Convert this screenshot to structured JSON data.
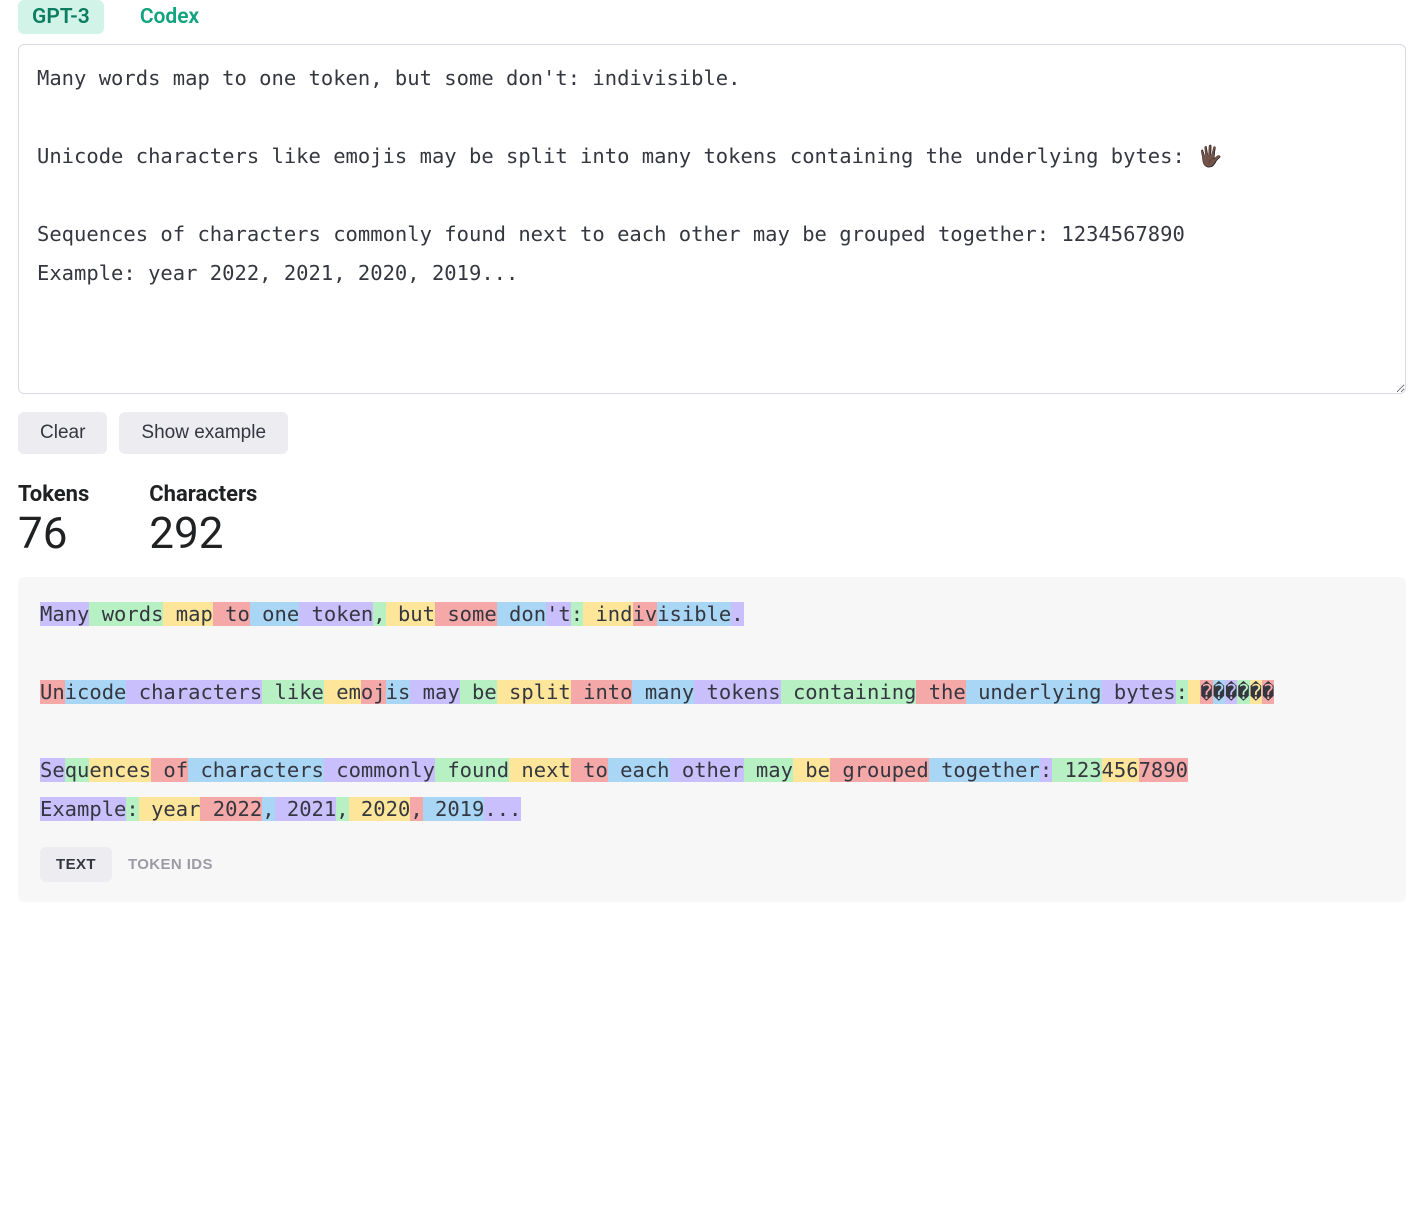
{
  "tabs": {
    "items": [
      {
        "label": "GPT-3",
        "active": true
      },
      {
        "label": "Codex",
        "active": false
      }
    ]
  },
  "input": {
    "text": "Many words map to one token, but some don't: indivisible.\n\nUnicode characters like emojis may be split into many tokens containing the underlying bytes: 🖐🏿\n\nSequences of characters commonly found next to each other may be grouped together: 1234567890\nExample: year 2022, 2021, 2020, 2019..."
  },
  "buttons": {
    "clear": "Clear",
    "show_example": "Show example"
  },
  "stats": {
    "tokens_label": "Tokens",
    "tokens_value": "76",
    "characters_label": "Characters",
    "characters_value": "292"
  },
  "tokenized": {
    "tokens": [
      {
        "t": "Many",
        "c": 0
      },
      {
        "t": " words",
        "c": 1
      },
      {
        "t": " map",
        "c": 2
      },
      {
        "t": " to",
        "c": 3
      },
      {
        "t": " one",
        "c": 4
      },
      {
        "t": " token",
        "c": 0
      },
      {
        "t": ",",
        "c": 1
      },
      {
        "t": " but",
        "c": 2
      },
      {
        "t": " some",
        "c": 3
      },
      {
        "t": " don",
        "c": 4
      },
      {
        "t": "'t",
        "c": 0
      },
      {
        "t": ":",
        "c": 1
      },
      {
        "t": " ind",
        "c": 2
      },
      {
        "t": "iv",
        "c": 3
      },
      {
        "t": "isible",
        "c": 4
      },
      {
        "t": ".",
        "c": 0
      },
      {
        "t": "\n\n",
        "c": -1
      },
      {
        "t": "Un",
        "c": 3
      },
      {
        "t": "icode",
        "c": 4
      },
      {
        "t": " characters",
        "c": 0
      },
      {
        "t": " like",
        "c": 1
      },
      {
        "t": " em",
        "c": 2
      },
      {
        "t": "oj",
        "c": 3
      },
      {
        "t": "is",
        "c": 4
      },
      {
        "t": " may",
        "c": 0
      },
      {
        "t": " be",
        "c": 1
      },
      {
        "t": " split",
        "c": 2
      },
      {
        "t": " into",
        "c": 3
      },
      {
        "t": " many",
        "c": 4
      },
      {
        "t": " tokens",
        "c": 0
      },
      {
        "t": " containing",
        "c": 1
      },
      {
        "t": " the",
        "c": 3
      },
      {
        "t": " underlying",
        "c": 4
      },
      {
        "t": " bytes",
        "c": 0
      },
      {
        "t": ":",
        "c": 1
      },
      {
        "t": " ",
        "c": 2
      },
      {
        "t": "�",
        "c": 3
      },
      {
        "t": "�",
        "c": 4
      },
      {
        "t": "�",
        "c": 0
      },
      {
        "t": "�",
        "c": 1
      },
      {
        "t": "�",
        "c": 2
      },
      {
        "t": "�",
        "c": 3
      },
      {
        "t": "\n\n",
        "c": -1
      },
      {
        "t": "Se",
        "c": 0
      },
      {
        "t": "qu",
        "c": 1
      },
      {
        "t": "ences",
        "c": 2
      },
      {
        "t": " of",
        "c": 3
      },
      {
        "t": " characters",
        "c": 4
      },
      {
        "t": " commonly",
        "c": 0
      },
      {
        "t": " found",
        "c": 1
      },
      {
        "t": " next",
        "c": 2
      },
      {
        "t": " to",
        "c": 3
      },
      {
        "t": " each",
        "c": 4
      },
      {
        "t": " other",
        "c": 0
      },
      {
        "t": " may",
        "c": 1
      },
      {
        "t": " be",
        "c": 2
      },
      {
        "t": " grouped",
        "c": 3
      },
      {
        "t": " together",
        "c": 4
      },
      {
        "t": ":",
        "c": 0
      },
      {
        "t": " 123",
        "c": 1
      },
      {
        "t": "456",
        "c": 2
      },
      {
        "t": "7890",
        "c": 3
      },
      {
        "t": "\n",
        "c": -1
      },
      {
        "t": "Example",
        "c": 0
      },
      {
        "t": ":",
        "c": 1
      },
      {
        "t": " year",
        "c": 2
      },
      {
        "t": " 2022",
        "c": 3
      },
      {
        "t": ",",
        "c": 4
      },
      {
        "t": " 2021",
        "c": 0
      },
      {
        "t": ",",
        "c": 1
      },
      {
        "t": " 2020",
        "c": 2
      },
      {
        "t": ",",
        "c": 3
      },
      {
        "t": " 2019",
        "c": 4
      },
      {
        "t": "...",
        "c": 0
      }
    ]
  },
  "view_toggle": {
    "text": "TEXT",
    "token_ids": "TOKEN IDS"
  }
}
